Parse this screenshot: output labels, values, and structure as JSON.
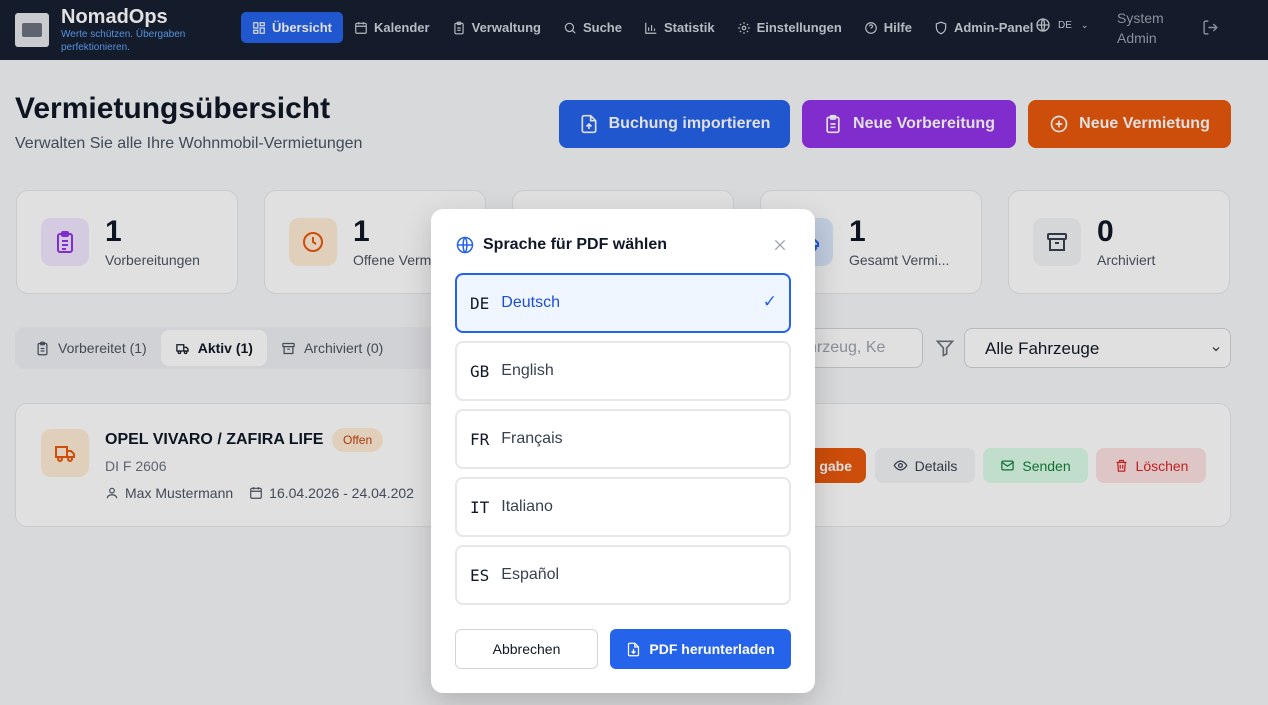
{
  "app": {
    "name": "NomadOps",
    "tagline": "Werte schützen. Übergaben perfektionieren."
  },
  "nav": {
    "items": [
      {
        "label": "Übersicht",
        "icon": "grid-icon",
        "active": true
      },
      {
        "label": "Kalender",
        "icon": "calendar-icon"
      },
      {
        "label": "Verwaltung",
        "icon": "clipboard-icon"
      },
      {
        "label": "Suche",
        "icon": "search-icon"
      },
      {
        "label": "Statistik",
        "icon": "chart-icon"
      },
      {
        "label": "Einstellungen",
        "icon": "gear-icon"
      },
      {
        "label": "Hilfe",
        "icon": "help-icon"
      },
      {
        "label": "Admin-Panel",
        "icon": "shield-icon"
      }
    ],
    "language": "DE",
    "user": "System Admin"
  },
  "header": {
    "title": "Vermietungsübersicht",
    "subtitle": "Verwalten Sie alle Ihre Wohnmobil-Vermietungen",
    "buttons": {
      "import": "Buchung importieren",
      "prepare": "Neue Vorbereitung",
      "new": "Neue Vermietung"
    }
  },
  "stats": [
    {
      "value": "1",
      "label": "Vorbereitungen"
    },
    {
      "value": "1",
      "label": "Offene Verm"
    },
    {
      "value": "1",
      "label": "Gesamt Vermi..."
    },
    {
      "value": "0",
      "label": "Archiviert"
    }
  ],
  "tabs": [
    {
      "label": "Vorbereitet (1)"
    },
    {
      "label": "Aktiv (1)",
      "active": true
    },
    {
      "label": "Archiviert (0)"
    }
  ],
  "filters": {
    "search_placeholder": "hrzeug, Ke",
    "vehicle_select": "Alle Fahrzeuge"
  },
  "rental": {
    "vehicle": "OPEL VIVARO / ZAFIRA LIFE",
    "status": "Offen",
    "plate": "DI F 2606",
    "customer": "Max Mustermann",
    "dates": "16.04.2026 - 24.04.202",
    "actions": {
      "handover": "gabe",
      "details": "Details",
      "send": "Senden",
      "delete": "Löschen"
    }
  },
  "modal": {
    "title": "Sprache für PDF wählen",
    "languages": [
      {
        "code": "DE",
        "name": "Deutsch",
        "selected": true
      },
      {
        "code": "GB",
        "name": "English"
      },
      {
        "code": "FR",
        "name": "Français"
      },
      {
        "code": "IT",
        "name": "Italiano"
      },
      {
        "code": "ES",
        "name": "Español"
      }
    ],
    "check": "✓",
    "cancel": "Abbrechen",
    "download": "PDF herunterladen"
  },
  "colors": {
    "nav_bg": "#172033",
    "primary": "#2563eb",
    "purple": "#9333ea",
    "orange": "#ea580c"
  }
}
